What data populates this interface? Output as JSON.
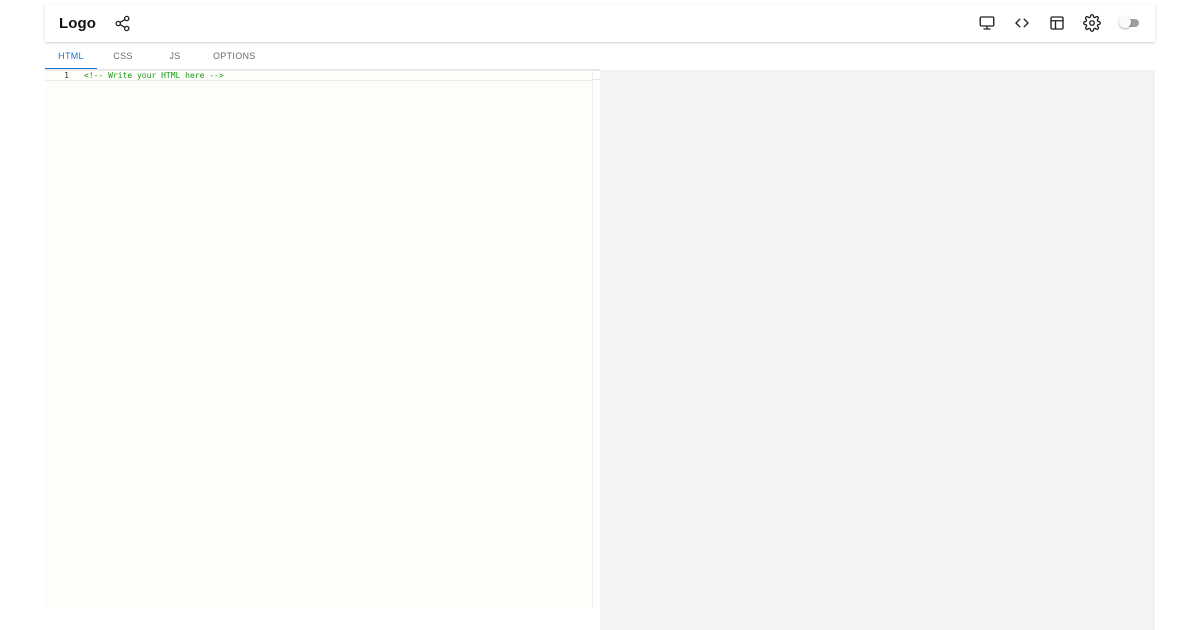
{
  "header": {
    "logo": "Logo",
    "left_icons": [
      "share-icon"
    ],
    "right_icons": [
      "desktop-monitor-icon",
      "code-brackets-icon",
      "layout-icon",
      "gear-icon"
    ],
    "toggle": {
      "state": "off"
    }
  },
  "tabs": [
    {
      "label": "HTML",
      "active": true
    },
    {
      "label": "CSS",
      "active": false
    },
    {
      "label": "JS",
      "active": false
    },
    {
      "label": "OPTIONS",
      "active": false
    }
  ],
  "editor": {
    "lines": [
      {
        "number": "1",
        "code": "<!-- Write your HTML here -->"
      }
    ]
  },
  "colors": {
    "accent": "#1976d2",
    "comment": "#1a9a1a",
    "preview_bg": "#f3f3f3",
    "editor_bg": "#fdfdfa"
  }
}
